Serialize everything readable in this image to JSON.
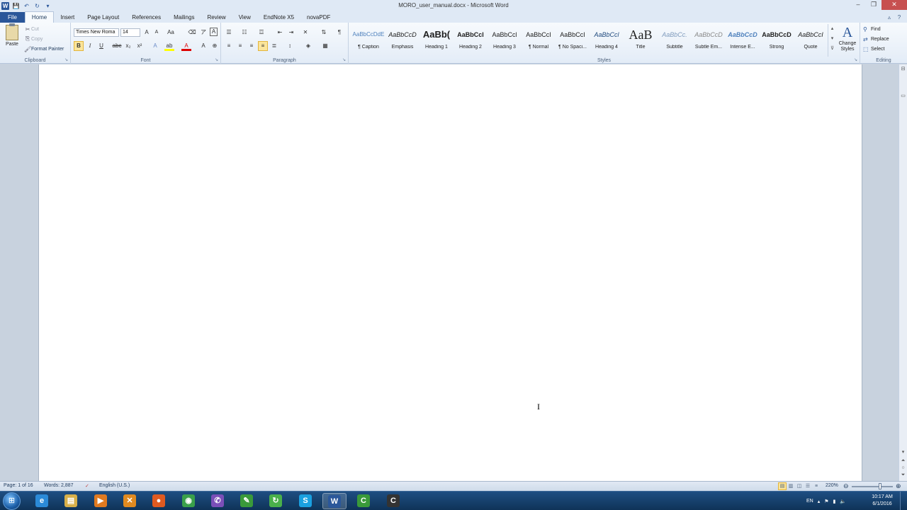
{
  "window": {
    "title": "MORO_user_manual.docx - Microsoft Word",
    "controls": {
      "minimize": "–",
      "maximize": "❐",
      "close": "✕"
    }
  },
  "qat": {
    "logo": "W",
    "save_icon": "💾",
    "undo_icon": "↶",
    "redo_icon": "↻",
    "customize_icon": "▾"
  },
  "tabs": [
    {
      "label": "File"
    },
    {
      "label": "Home"
    },
    {
      "label": "Insert"
    },
    {
      "label": "Page Layout"
    },
    {
      "label": "References"
    },
    {
      "label": "Mailings"
    },
    {
      "label": "Review"
    },
    {
      "label": "View"
    },
    {
      "label": "EndNote X5"
    },
    {
      "label": "novaPDF"
    }
  ],
  "ribbon": {
    "clipboard": {
      "label": "Clipboard",
      "paste": "Paste",
      "cut": "Cut",
      "copy": "Copy",
      "format_painter": "Format Painter"
    },
    "font": {
      "label": "Font",
      "family": "Times New Roma",
      "size": "14"
    },
    "paragraph": {
      "label": "Paragraph"
    },
    "styles": {
      "label": "Styles",
      "items": [
        {
          "preview": "AaBbCcDdE",
          "name": "¶ Caption"
        },
        {
          "preview": "AaBbCcD",
          "name": "Emphasis"
        },
        {
          "preview": "AaBb(",
          "name": "Heading 1"
        },
        {
          "preview": "AaBbCcl",
          "name": "Heading 2"
        },
        {
          "preview": "AaBbCcl",
          "name": "Heading 3"
        },
        {
          "preview": "AaBbCcI",
          "name": "¶ Normal"
        },
        {
          "preview": "AaBbCcI",
          "name": "¶ No Spaci..."
        },
        {
          "preview": "AaBbCcl",
          "name": "Heading 4"
        },
        {
          "preview": "AaB",
          "name": "Title"
        },
        {
          "preview": "AaBbCc.",
          "name": "Subtitle"
        },
        {
          "preview": "AaBbCcD",
          "name": "Subtle Em..."
        },
        {
          "preview": "AaBbCcD",
          "name": "Intense E..."
        },
        {
          "preview": "AaBbCcD",
          "name": "Strong"
        },
        {
          "preview": "AaBbCcI",
          "name": "Quote"
        }
      ],
      "change_styles": "Change Styles"
    },
    "editing": {
      "label": "Editing",
      "find": "Find",
      "replace": "Replace",
      "select": "Select"
    }
  },
  "status": {
    "page": "Page: 1 of 16",
    "words": "Words: 2,887",
    "language": "English (U.S.)",
    "zoom": "220%"
  },
  "tray": {
    "lang": "EN",
    "time": "10:17 AM",
    "date": "6/1/2016"
  },
  "taskbar_apps": [
    {
      "name": "Internet Explorer",
      "glyph": "e",
      "color": "#2b8ad8"
    },
    {
      "name": "Windows Explorer",
      "glyph": "▤",
      "color": "#d8b04a"
    },
    {
      "name": "Media Player",
      "glyph": "▶",
      "color": "#e07a20"
    },
    {
      "name": "Tool",
      "glyph": "✕",
      "color": "#e08a20"
    },
    {
      "name": "Firefox",
      "glyph": "●",
      "color": "#e05a20"
    },
    {
      "name": "Chrome",
      "glyph": "◉",
      "color": "#3aa04a"
    },
    {
      "name": "Viber",
      "glyph": "✆",
      "color": "#7b4fb8"
    },
    {
      "name": "Editor",
      "glyph": "✎",
      "color": "#3a9a3a"
    },
    {
      "name": "Sync",
      "glyph": "↻",
      "color": "#4ab04a"
    },
    {
      "name": "Skype",
      "glyph": "S",
      "color": "#1aa0e0"
    },
    {
      "name": "Word",
      "glyph": "W",
      "color": "#2b579a"
    },
    {
      "name": "Camtasia",
      "glyph": "C",
      "color": "#3a9a3a"
    },
    {
      "name": "Camtasia Recorder",
      "glyph": "C",
      "color": "#333333"
    }
  ]
}
